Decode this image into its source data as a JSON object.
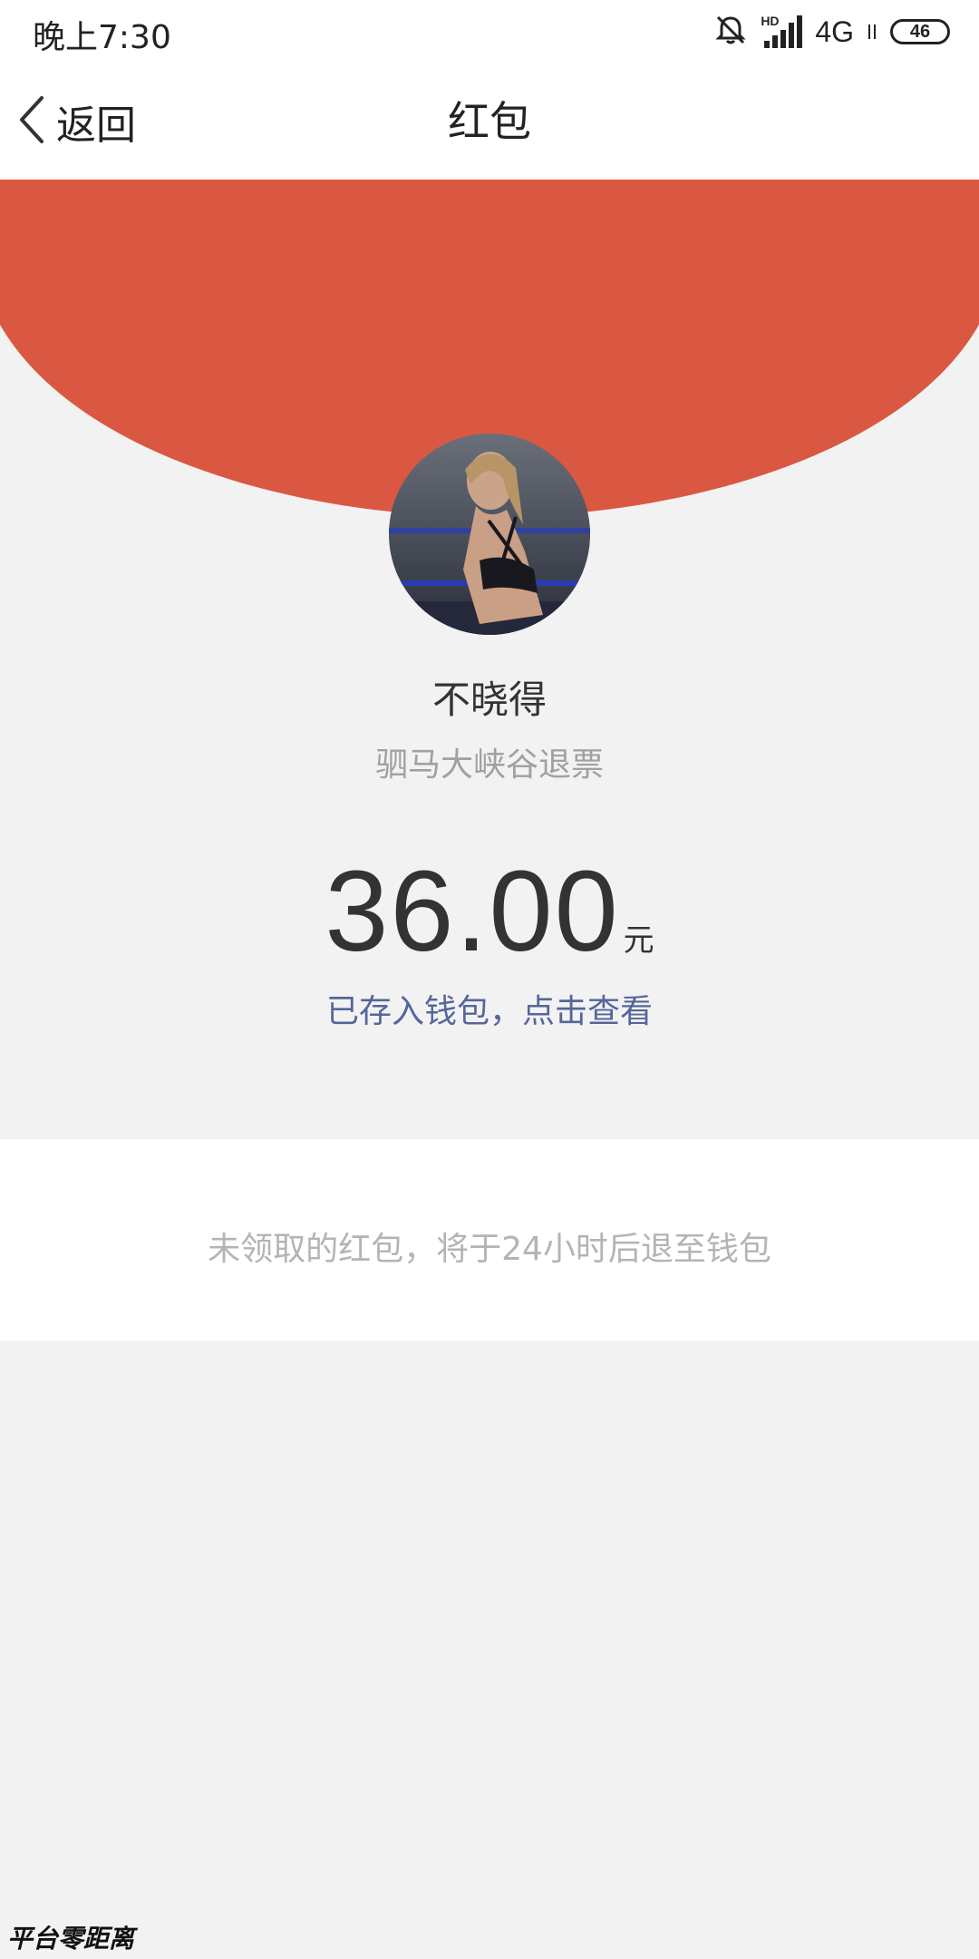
{
  "status_bar": {
    "time": "晚上7:30",
    "hd_label": "HD",
    "network": "4G",
    "battery": "46",
    "icons": [
      "bell-muted-icon",
      "signal-icon",
      "battery-icon"
    ]
  },
  "nav": {
    "back_label": "返回",
    "title": "红包"
  },
  "colors": {
    "header_red": "#da5842",
    "link_blue": "#56669a",
    "background": "#f2f2f2"
  },
  "packet": {
    "sender_name": "不晓得",
    "remark": "驷马大峡谷退票",
    "amount": "36.00",
    "currency_unit": "元",
    "wallet_link": "已存入钱包，点击查看"
  },
  "notice": {
    "text": "未领取的红包，将于24小时后退至钱包"
  },
  "watermark": "平台零距离"
}
